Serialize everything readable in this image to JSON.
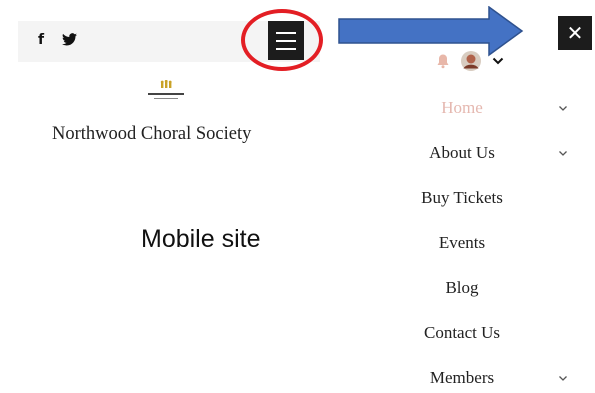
{
  "header": {
    "social": [
      {
        "label": "f",
        "icon": "facebook-icon"
      },
      {
        "label": "𝕐",
        "icon": "twitter-icon"
      }
    ]
  },
  "site": {
    "name": "Northwood Choral Society"
  },
  "annotation": {
    "label": "Mobile site"
  },
  "colors": {
    "highlight": "#e31e24",
    "arrow": "#4472c4",
    "active_nav": "#e5b8b0",
    "dark": "#1c1c1c"
  },
  "nav": {
    "items": [
      {
        "label": "Home",
        "active": true,
        "has_submenu": true
      },
      {
        "label": "About Us",
        "active": false,
        "has_submenu": true
      },
      {
        "label": "Buy Tickets",
        "active": false,
        "has_submenu": false
      },
      {
        "label": "Events",
        "active": false,
        "has_submenu": false
      },
      {
        "label": "Blog",
        "active": false,
        "has_submenu": false
      },
      {
        "label": "Contact Us",
        "active": false,
        "has_submenu": false
      },
      {
        "label": "Members",
        "active": false,
        "has_submenu": true
      }
    ]
  }
}
